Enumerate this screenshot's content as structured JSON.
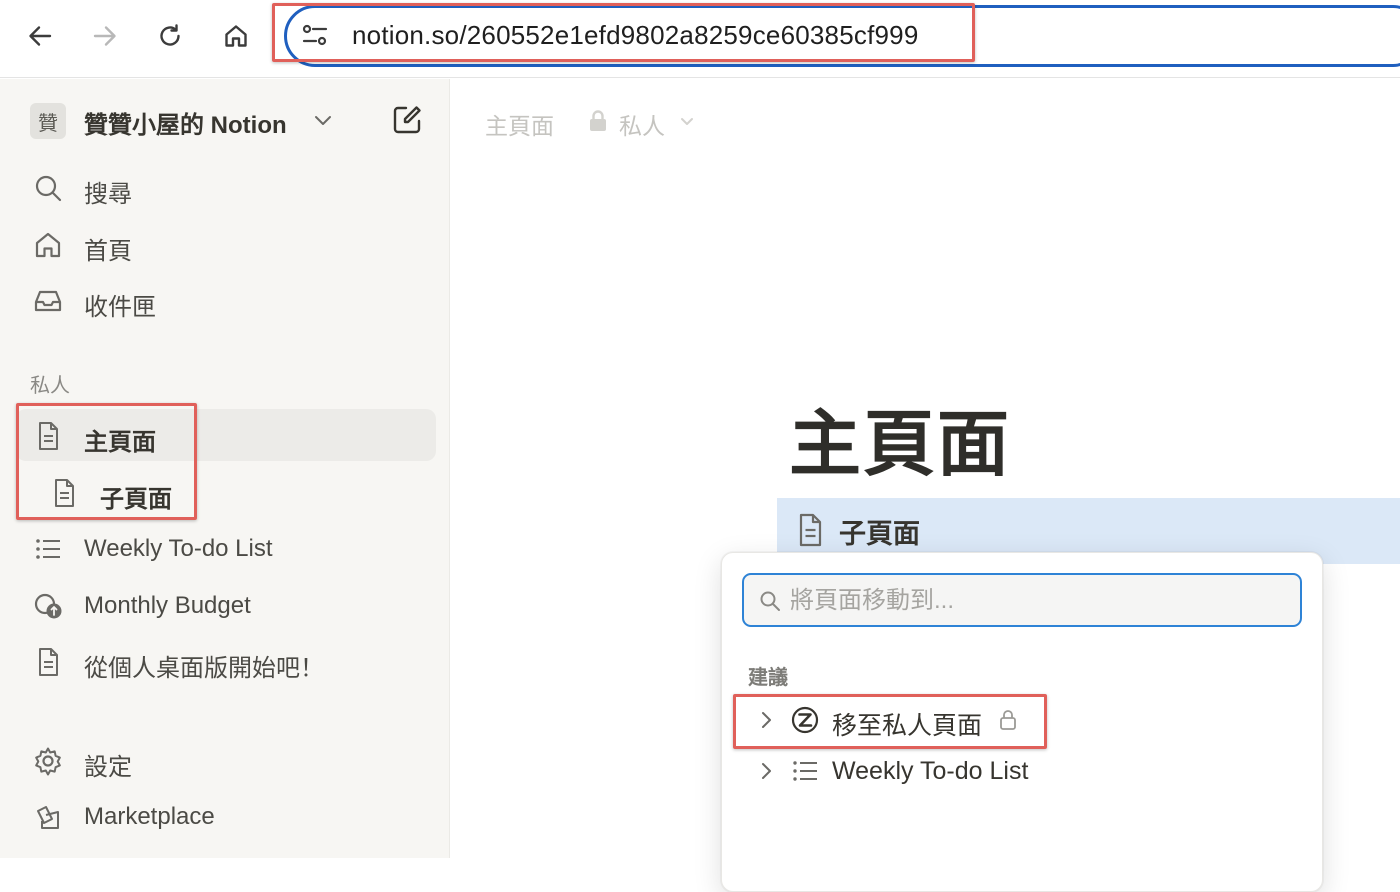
{
  "browser": {
    "url": "notion.so/260552e1efd9802a8259ce60385cf999"
  },
  "sidebar": {
    "workspace_avatar": "贊",
    "workspace_name": "贊贊小屋的 Notion",
    "nav": [
      {
        "label": "搜尋",
        "icon": "search-icon"
      },
      {
        "label": "首頁",
        "icon": "home-icon"
      },
      {
        "label": "收件匣",
        "icon": "inbox-icon"
      }
    ],
    "section_label": "私人",
    "pages": [
      {
        "label": "主頁面",
        "icon": "page-icon",
        "active": true
      },
      {
        "label": "子頁面",
        "icon": "page-icon"
      },
      {
        "label": "Weekly To-do List",
        "icon": "list-icon"
      },
      {
        "label": "Monthly Budget",
        "icon": "budget-icon"
      },
      {
        "label": "從個人桌面版開始吧！",
        "icon": "page-icon"
      }
    ],
    "footer": [
      {
        "label": "設定",
        "icon": "settings-icon"
      },
      {
        "label": "Marketplace",
        "icon": "marketplace-icon"
      }
    ]
  },
  "main": {
    "breadcrumb_page": "主頁面",
    "breadcrumb_visibility": "私人",
    "page_title": "主頁面",
    "subpage_block_label": "子頁面"
  },
  "move_popup": {
    "search_placeholder": "將頁面移動到...",
    "suggestions_label": "建議",
    "items": [
      {
        "label": "移至私人頁面",
        "icon": "private-workspace-icon",
        "locked": true
      },
      {
        "label": "Weekly To-do List",
        "icon": "list-icon"
      }
    ]
  },
  "colors": {
    "highlight_box": "#e0605a",
    "selection_blue": "#dbe8f7",
    "focus_ring": "#2e83d6",
    "sidebar_bg": "#f7f6f3"
  }
}
